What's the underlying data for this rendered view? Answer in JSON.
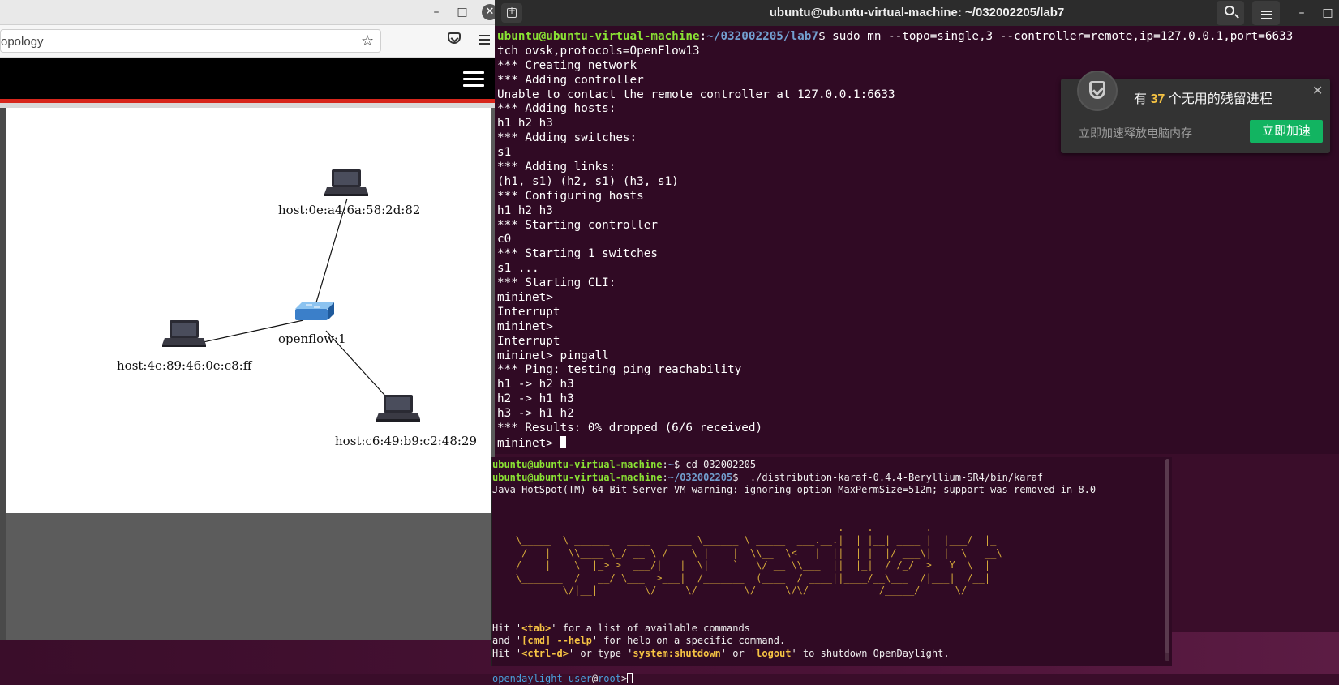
{
  "browser": {
    "url_partial": "opology",
    "window_buttons": {
      "minimize": "–",
      "maximize": "□",
      "close": "✕"
    },
    "topology": {
      "hosts": [
        {
          "label": "host:0e:a4:6a:58:2d:82"
        },
        {
          "label": "host:4e:89:46:0e:c8:ff"
        },
        {
          "label": "host:c6:49:b9:c2:48:29"
        }
      ],
      "switch": {
        "label": "openflow:1"
      }
    }
  },
  "terminal": {
    "title": "ubuntu@ubuntu-virtual-machine: ~/032002205/lab7",
    "prompt_user": "ubuntu@ubuntu-virtual-machine",
    "prompt_path": "~/032002205/lab7",
    "command": "$ sudo mn --topo=single,3 --controller=remote,ip=127.0.0.1,port=6633",
    "lines": [
      "tch ovsk,protocols=OpenFlow13",
      "*** Creating network",
      "*** Adding controller",
      "Unable to contact the remote controller at 127.0.0.1:6633",
      "*** Adding hosts:",
      "h1 h2 h3",
      "*** Adding switches:",
      "s1",
      "*** Adding links:",
      "(h1, s1) (h2, s1) (h3, s1)",
      "*** Configuring hosts",
      "h1 h2 h3",
      "*** Starting controller",
      "c0",
      "*** Starting 1 switches",
      "s1 ...",
      "*** Starting CLI:",
      "mininet>",
      "Interrupt",
      "mininet>",
      "Interrupt",
      "mininet> pingall",
      "*** Ping: testing ping reachability",
      "h1 -> h2 h3",
      "h2 -> h1 h3",
      "h3 -> h1 h2",
      "*** Results: 0% dropped (6/6 received)"
    ],
    "final_prompt": "mininet> "
  },
  "popup": {
    "msg_prefix": "有 ",
    "count": "37",
    "msg_suffix": " 个无用的残留进程",
    "sub": "立即加速释放电脑内存",
    "button": "立即加速",
    "close": "✕"
  },
  "terminal2": {
    "l1_user": "ubuntu@ubuntu-virtual-machine",
    "l1_path": "~",
    "l1_cmd": "$ cd 032002205",
    "l2_user": "ubuntu@ubuntu-virtual-machine",
    "l2_path": "~/032002205",
    "l2_cmd": "$  ./distribution-karaf-0.4.4-Beryllium-SR4/bin/karaf",
    "l3": "Java HotSpot(TM) 64-Bit Server VM warning: ignoring option MaxPermSize=512m; support was removed in 8.0",
    "logo": [
      "    ________                       ________                .__  .__       .__     __",
      "    \\_____  \\ ______   ____   ____ \\______ \\ _____  ___.__.|  | |__| ____ |  |___/  |_",
      "     /   |   \\\\____ \\_/ __ \\ /    \\ |    |  \\\\__  \\<   |  ||  | |  |/ ___\\|  |  \\   __\\",
      "    /    |    \\  |_> >  ___/|   |  \\|    `   \\/ __ \\\\___  ||  |_|  / /_/  >   Y  \\  |",
      "    \\_______  /   __/ \\___  >___|  /_______  (____  / ____||____/__\\___  /|___|  /__|",
      "            \\/|__|        \\/     \\/        \\/     \\/\\/            /_____/      \\/"
    ],
    "help1_a": "Hit '",
    "help1_k": "<tab>",
    "help1_b": "' for a list of available commands",
    "help2_a": "and '",
    "help2_k": "[cmd] --help",
    "help2_b": "' for help on a specific command.",
    "help3_a": "Hit '",
    "help3_k1": "<ctrl-d>",
    "help3_b": "' or type '",
    "help3_k2": "system:shutdown",
    "help3_c": "' or '",
    "help3_k3": "logout",
    "help3_d": "' to shutdown OpenDaylight.",
    "od_user": "opendaylight-user",
    "od_at": "@",
    "od_host": "root",
    "od_gt": ">"
  }
}
